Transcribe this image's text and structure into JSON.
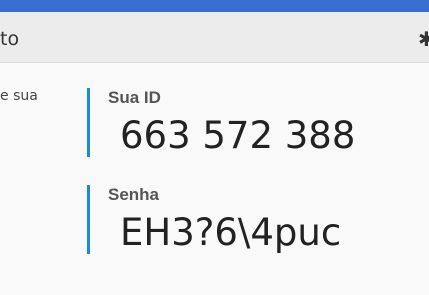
{
  "header": {
    "title_fragment": "to",
    "settings_icon": "gear-icon"
  },
  "sidebar": {
    "text_fragment": "e sua"
  },
  "credentials": {
    "id_label": "Sua ID",
    "id_value": "663 572 388",
    "password_label": "Senha",
    "password_value": "EH3?6\\4puc"
  },
  "colors": {
    "accent_bar": "#3a6fd2",
    "field_border": "#1b8ccf"
  }
}
